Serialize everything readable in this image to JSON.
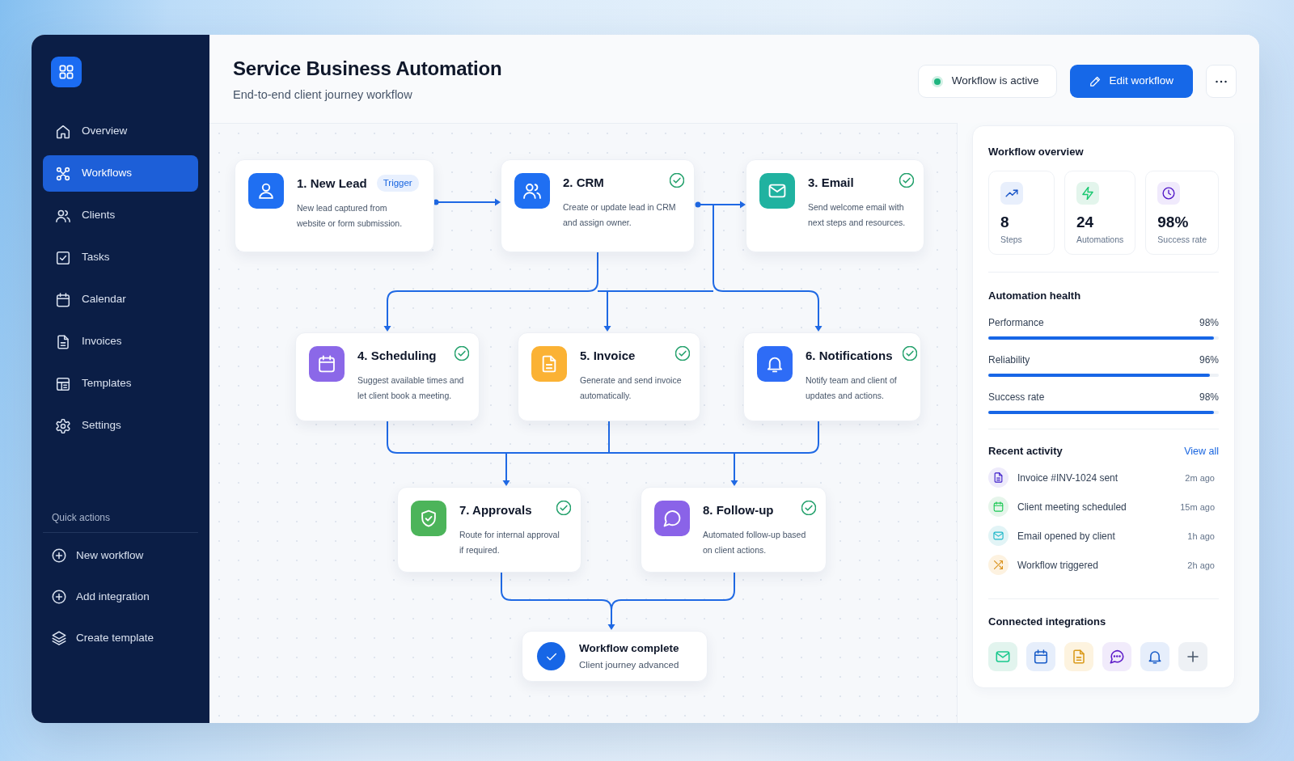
{
  "sidebar": {
    "items": [
      {
        "label": "Overview",
        "selected": false
      },
      {
        "label": "Workflows",
        "selected": true
      },
      {
        "label": "Clients",
        "selected": false
      },
      {
        "label": "Tasks",
        "selected": false
      },
      {
        "label": "Calendar",
        "selected": false
      },
      {
        "label": "Invoices",
        "selected": false
      },
      {
        "label": "Templates",
        "selected": false
      },
      {
        "label": "Settings",
        "selected": false
      }
    ],
    "quick_actions": {
      "title": "Quick actions",
      "items": [
        {
          "label": "New workflow"
        },
        {
          "label": "Add integration"
        },
        {
          "label": "Create template"
        }
      ]
    }
  },
  "header": {
    "title": "Service Business Automation",
    "subtitle": "End-to-end client journey workflow",
    "status": {
      "label": "Workflow is active",
      "active": true
    },
    "edit_button": "Edit workflow"
  },
  "flow": {
    "nodes": [
      {
        "title": "1. New Lead",
        "badge": "Trigger",
        "description": "New lead captured from\nwebsite or form submission.",
        "completed": false,
        "color": "#1f6ff2"
      },
      {
        "title": "2. CRM",
        "description": "Create or update lead in CRM\nand assign owner.",
        "completed": true,
        "color": "#1f6ff2"
      },
      {
        "title": "3. Email",
        "description": "Send welcome email with\nnext steps and resources.",
        "completed": true,
        "color": "#20b2a0"
      },
      {
        "title": "4. Scheduling",
        "description": "Suggest available times and\nlet client book a meeting.",
        "completed": true,
        "color": "#8b68e8"
      },
      {
        "title": "5. Invoice",
        "description": "Generate and send invoice\nautomatically.",
        "completed": true,
        "color": "#fbb234"
      },
      {
        "title": "6. Notifications",
        "description": "Notify team and client of\nupdates and actions.",
        "completed": true,
        "color": "#2e6cf6"
      },
      {
        "title": "7. Approvals",
        "description": "Route for internal approval\nif required.",
        "completed": true,
        "color": "#4cb45a"
      },
      {
        "title": "8. Follow-up",
        "description": "Automated follow-up based\non client actions.",
        "completed": true,
        "color": "#8a63e8"
      }
    ],
    "end": {
      "title": "Workflow complete",
      "subtitle": "Client journey advanced"
    }
  },
  "overview": {
    "title": "Workflow overview",
    "stats": [
      {
        "value": "8",
        "label": "Steps",
        "color": "#e8effc"
      },
      {
        "value": "24",
        "label": "Automations",
        "color": "#e3f5ec"
      },
      {
        "value": "98%",
        "label": "Success rate",
        "color": "#f0eafc"
      }
    ]
  },
  "health": {
    "title": "Automation health",
    "metrics": [
      {
        "label": "Performance",
        "reading": "98%",
        "level": 0.98
      },
      {
        "label": "Reliability",
        "reading": "96%",
        "level": 0.96
      },
      {
        "label": "Success rate",
        "reading": "98%",
        "level": 0.98
      }
    ]
  },
  "activity": {
    "title": "Recent activity",
    "link": "View all",
    "items": [
      {
        "text": "Invoice #INV-1024 sent",
        "time": "2m ago",
        "color": "#eeebfb"
      },
      {
        "text": "Client meeting scheduled",
        "time": "15m ago",
        "color": "#e6f5eb"
      },
      {
        "text": "Email opened by client",
        "time": "1h ago",
        "color": "#e2f4f6"
      },
      {
        "text": "Workflow triggered",
        "time": "2h ago",
        "color": "#fdf2e0"
      }
    ]
  },
  "integrations": {
    "title": "Connected integrations",
    "apps": [
      {
        "color": "#e2f4ee"
      },
      {
        "color": "#e6eefb"
      },
      {
        "color": "#fdf3df"
      },
      {
        "color": "#f1ebfb"
      },
      {
        "color": "#e6eefb"
      }
    ]
  }
}
